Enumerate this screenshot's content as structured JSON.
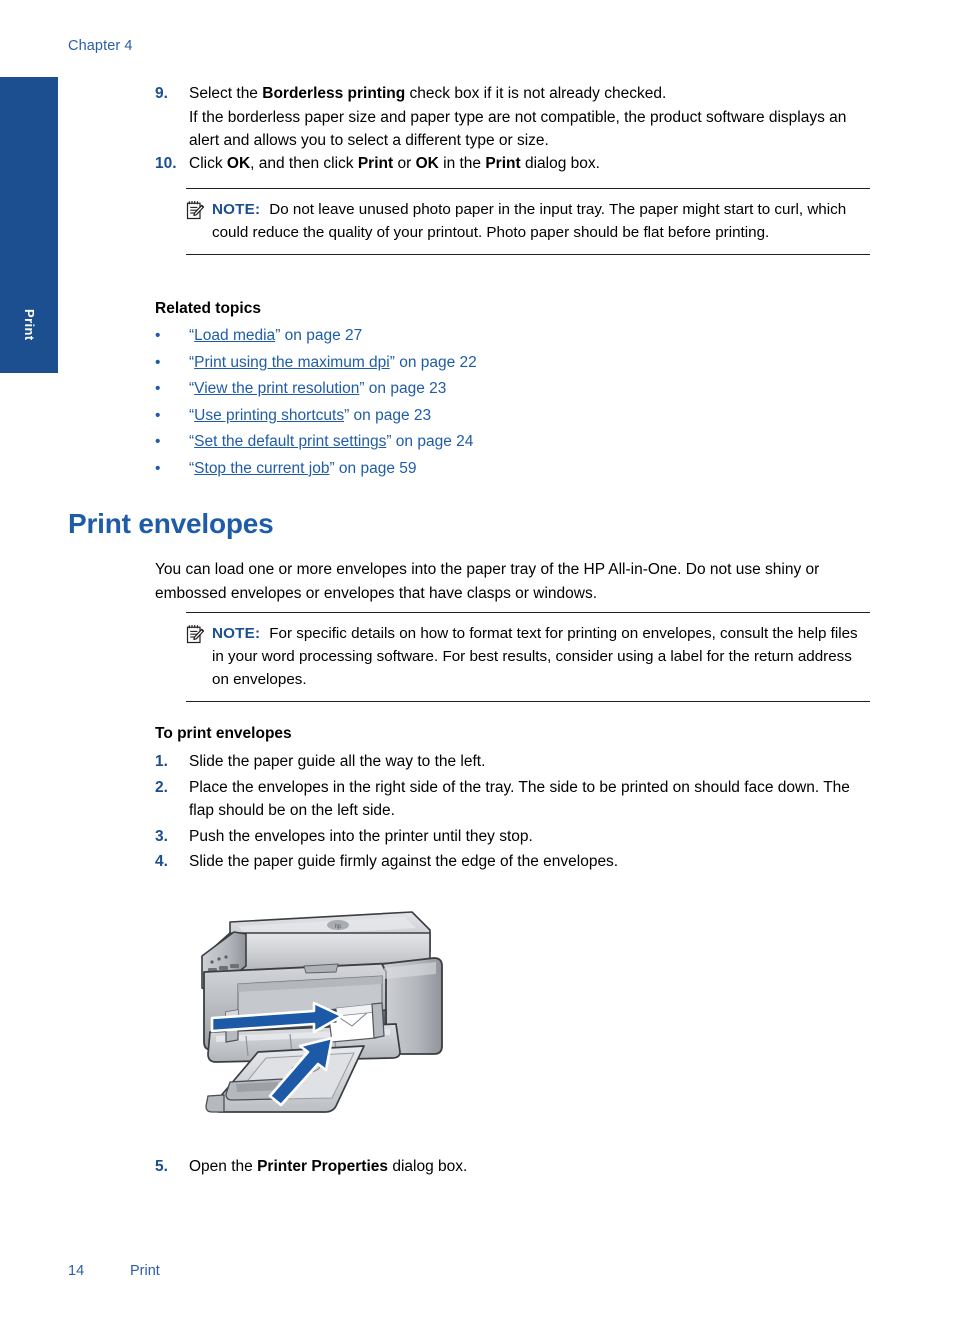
{
  "header": {
    "chapter": "Chapter 4"
  },
  "side_tab": {
    "label": "Print"
  },
  "steps_continued": [
    {
      "number": "9.",
      "line1_pre": "Select the ",
      "line1_bold": "Borderless printing",
      "line1_post": " check box if it is not already checked.",
      "line2": "If the borderless paper size and paper type are not compatible, the product software displays an alert and allows you to select a different type or size."
    },
    {
      "number": "10.",
      "pre": "Click ",
      "b1": "OK",
      "mid1": ", and then click ",
      "b2": "Print",
      "mid2": " or ",
      "b3": "OK",
      "mid3": " in the ",
      "b4": "Print",
      "post": " dialog box."
    }
  ],
  "note_photo": {
    "label": "NOTE:",
    "text": "Do not leave unused photo paper in the input tray. The paper might start to curl, which could reduce the quality of your printout. Photo paper should be flat before printing."
  },
  "related": {
    "heading": "Related topics",
    "bullet": "•",
    "items": [
      {
        "quote_open": "“",
        "link": "Load media",
        "quote_close": "”",
        "tail": " on page 27"
      },
      {
        "quote_open": "“",
        "link": "Print using the maximum dpi",
        "quote_close": "”",
        "tail": " on page 22"
      },
      {
        "quote_open": "“",
        "link": "View the print resolution",
        "quote_close": "”",
        "tail": " on page 23"
      },
      {
        "quote_open": "“",
        "link": "Use printing shortcuts",
        "quote_close": "”",
        "tail": " on page 23"
      },
      {
        "quote_open": "“",
        "link": "Set the default print settings",
        "quote_close": "”",
        "tail": " on page 24"
      },
      {
        "quote_open": "“",
        "link": "Stop the current job",
        "quote_close": "”",
        "tail": " on page 59"
      }
    ]
  },
  "section": {
    "title": "Print envelopes",
    "intro": "You can load one or more envelopes into the paper tray of the HP All-in-One. Do not use shiny or embossed envelopes or envelopes that have clasps or windows."
  },
  "note_envelopes": {
    "label": "NOTE:",
    "text": "For specific details on how to format text for printing on envelopes, consult the help files in your word processing software. For best results, consider using a label for the return address on envelopes."
  },
  "procedure": {
    "heading": "To print envelopes",
    "steps": [
      {
        "number": "1.",
        "text": "Slide the paper guide all the way to the left."
      },
      {
        "number": "2.",
        "text": "Place the envelopes in the right side of the tray. The side to be printed on should face down. The flap should be on the left side."
      },
      {
        "number": "3.",
        "text": "Push the envelopes into the printer until they stop."
      },
      {
        "number": "4.",
        "text": "Slide the paper guide firmly against the edge of the envelopes."
      }
    ]
  },
  "step5": {
    "number": "5.",
    "pre": "Open the ",
    "bold": "Printer Properties",
    "post": " dialog box."
  },
  "figure": {
    "alt_name": "hp-all-in-one-printer-illustration",
    "arrow_color": "#1c5aa8",
    "body_color": "#b9bcc1"
  },
  "footer": {
    "page_number": "14",
    "section_name": "Print"
  },
  "colors": {
    "heading_blue": "#1f5ca8",
    "tab_blue": "#1b4f8f",
    "header_blue": "#2b5fa5",
    "link_blue": "#1f5ca8",
    "rule": "#231f20"
  }
}
